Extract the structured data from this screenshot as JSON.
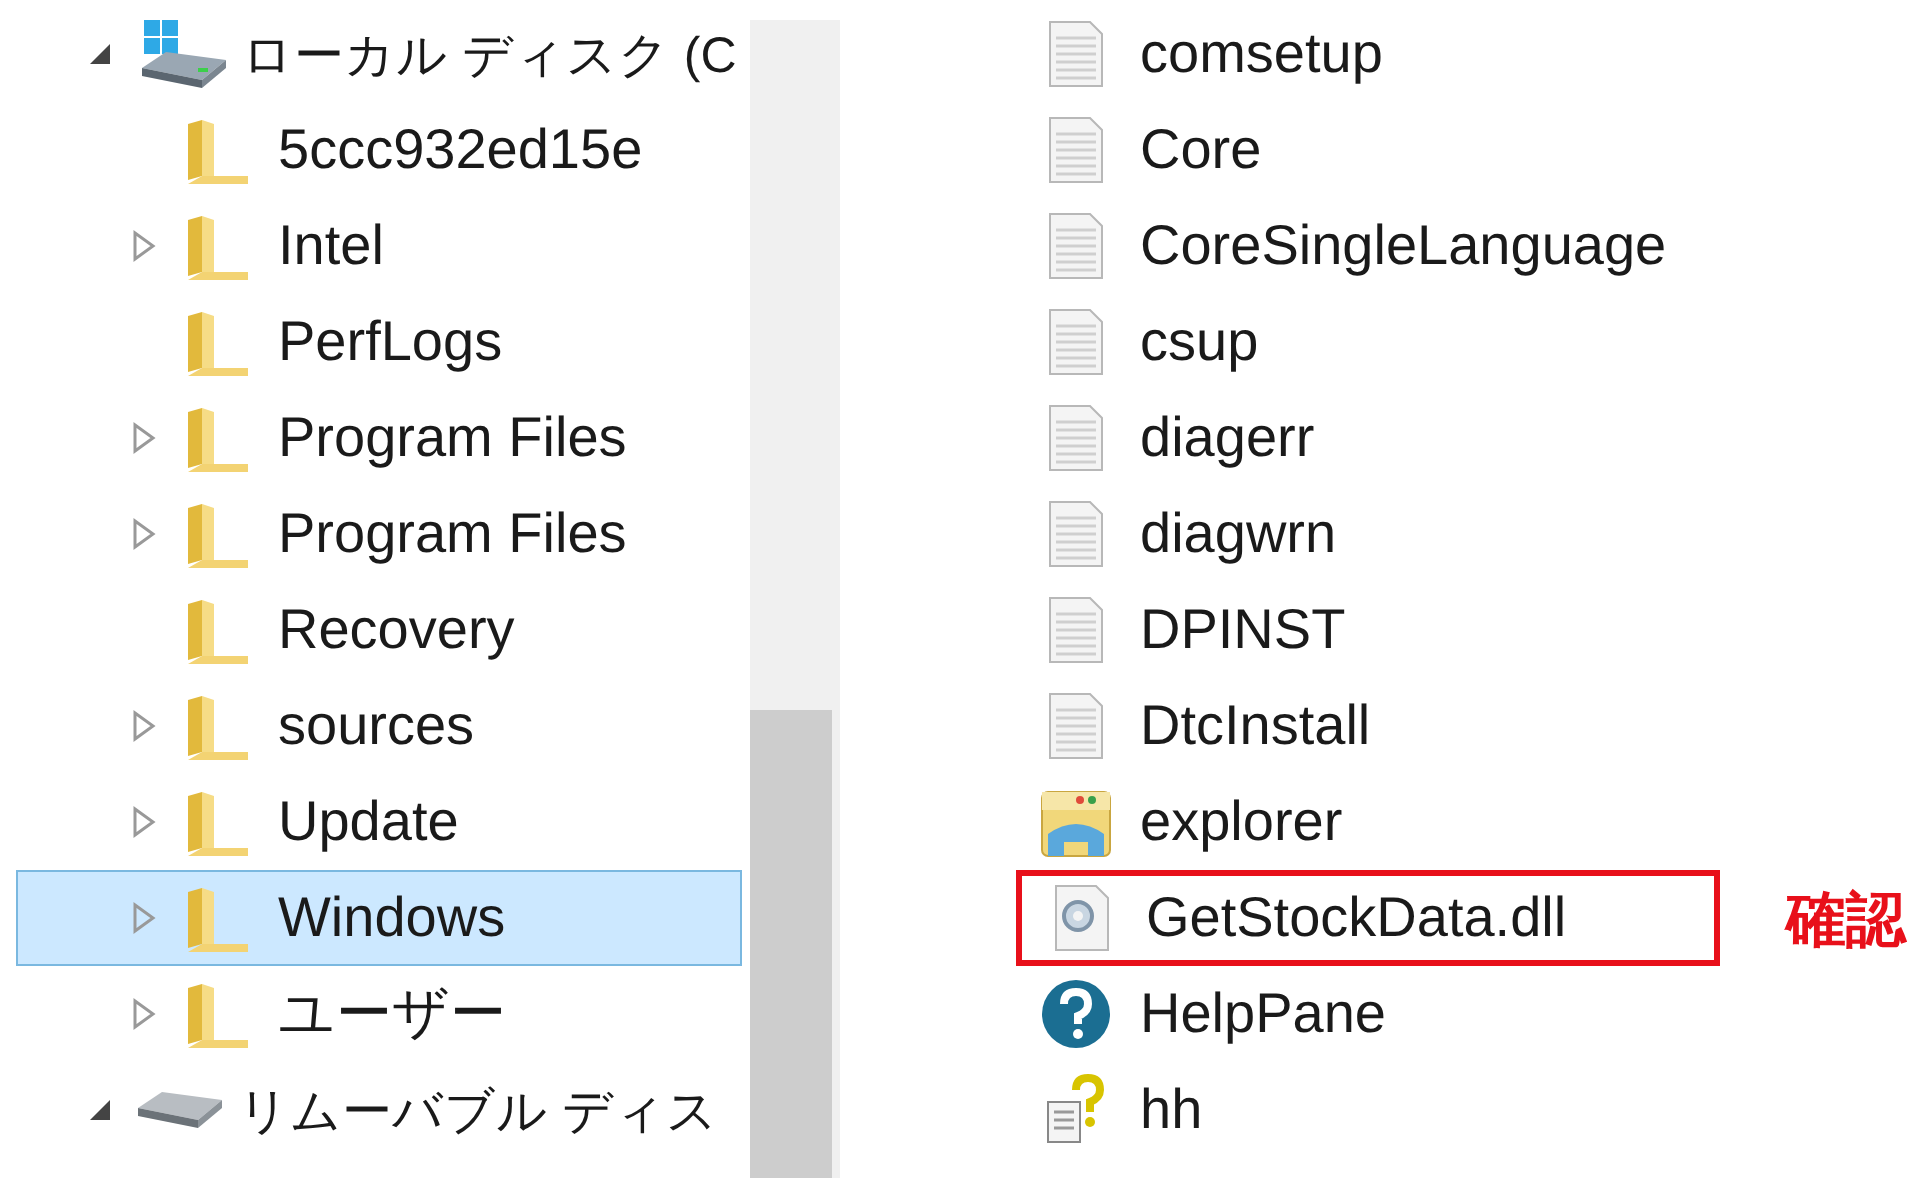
{
  "tree": [
    {
      "label": "ローカル ディスク (C",
      "kind": "drive",
      "expandable": true,
      "expanded": true,
      "selected": false,
      "children": [
        {
          "label": "5ccc932ed15e",
          "expandable": false,
          "selected": false
        },
        {
          "label": "Intel",
          "expandable": true,
          "expanded": false,
          "selected": false
        },
        {
          "label": "PerfLogs",
          "expandable": false,
          "selected": false
        },
        {
          "label": "Program Files",
          "expandable": true,
          "expanded": false,
          "selected": false
        },
        {
          "label": "Program Files",
          "expandable": true,
          "expanded": false,
          "selected": false
        },
        {
          "label": "Recovery",
          "expandable": false,
          "selected": false
        },
        {
          "label": "sources",
          "expandable": true,
          "expanded": false,
          "selected": false
        },
        {
          "label": "Update",
          "expandable": true,
          "expanded": false,
          "selected": false
        },
        {
          "label": "Windows",
          "expandable": true,
          "expanded": false,
          "selected": true
        },
        {
          "label": "ユーザー",
          "expandable": true,
          "expanded": false,
          "selected": false
        }
      ]
    },
    {
      "label": "リムーバブル ディス",
      "kind": "removable",
      "expandable": true,
      "expanded": true,
      "selected": false
    }
  ],
  "files": [
    {
      "name": "comsetup",
      "kind": "document",
      "highlighted": false
    },
    {
      "name": "Core",
      "kind": "document",
      "highlighted": false
    },
    {
      "name": "CoreSingleLanguage",
      "kind": "document",
      "highlighted": false
    },
    {
      "name": "csup",
      "kind": "document",
      "highlighted": false
    },
    {
      "name": "diagerr",
      "kind": "document",
      "highlighted": false
    },
    {
      "name": "diagwrn",
      "kind": "document",
      "highlighted": false
    },
    {
      "name": "DPINST",
      "kind": "document",
      "highlighted": false
    },
    {
      "name": "DtcInstall",
      "kind": "document",
      "highlighted": false
    },
    {
      "name": "explorer",
      "kind": "app",
      "highlighted": false
    },
    {
      "name": "GetStockData.dll",
      "kind": "dll",
      "highlighted": true
    },
    {
      "name": "HelpPane",
      "kind": "help",
      "highlighted": false
    },
    {
      "name": "hh",
      "kind": "helpdoc",
      "highlighted": false
    }
  ],
  "note": {
    "label": "確認"
  }
}
